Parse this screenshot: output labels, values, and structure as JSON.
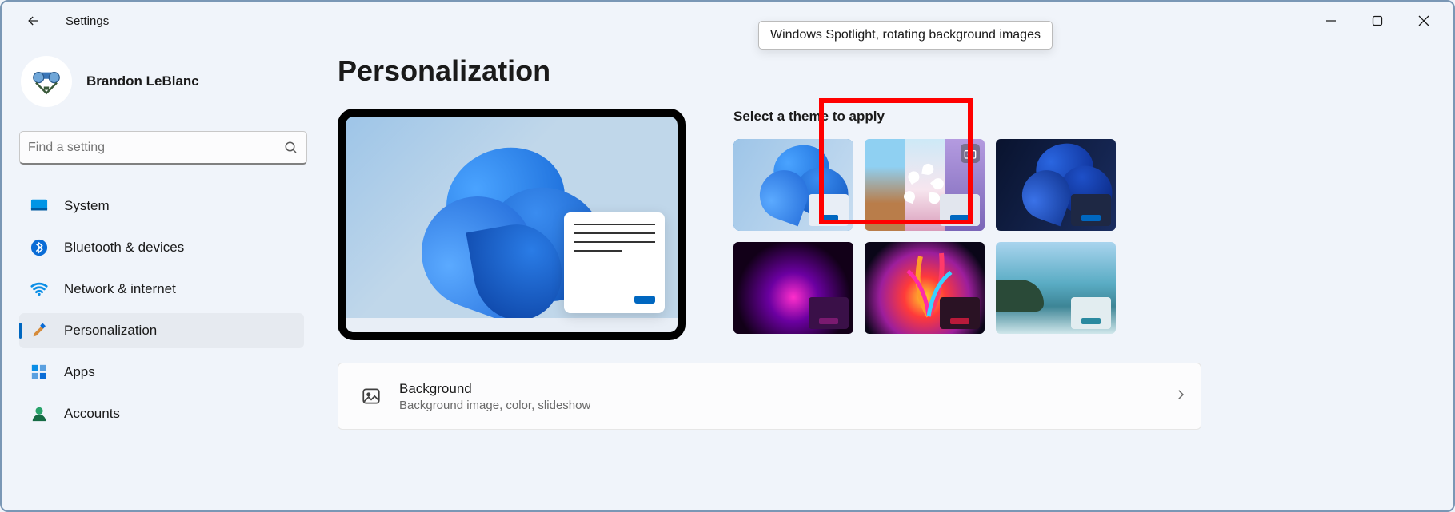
{
  "window_title": "Settings",
  "user": {
    "display_name": "Brandon LeBlanc"
  },
  "search": {
    "placeholder": "Find a setting"
  },
  "sidebar": {
    "items": [
      {
        "label": "System"
      },
      {
        "label": "Bluetooth & devices"
      },
      {
        "label": "Network & internet"
      },
      {
        "label": "Personalization"
      },
      {
        "label": "Apps"
      },
      {
        "label": "Accounts"
      }
    ]
  },
  "page_title": "Personalization",
  "themes_header": "Select a theme to apply",
  "tooltip_text": "Windows Spotlight, rotating background images",
  "settings_rows": [
    {
      "title": "Background",
      "subtitle": "Background image, color, slideshow"
    }
  ]
}
